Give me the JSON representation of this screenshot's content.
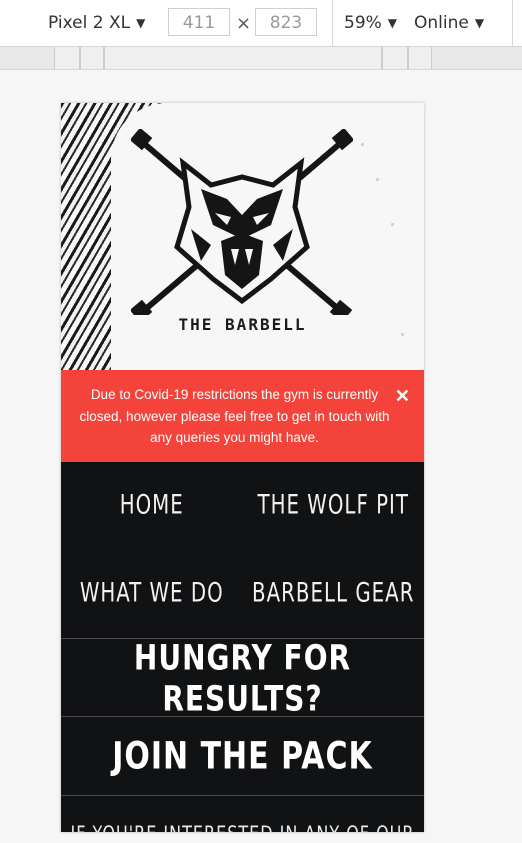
{
  "devtools": {
    "device": "Pixel 2 XL",
    "width": "411",
    "height": "823",
    "zoom": "59%",
    "network": "Online",
    "times_symbol": "×"
  },
  "site": {
    "brand": "THE BARBELL",
    "notice": {
      "text": "Due to Covid-19 restrictions the gym is currently closed, however please feel free to get in touch with any queries you might have.",
      "close": "✕"
    },
    "nav": [
      {
        "label": "HOME"
      },
      {
        "label": "THE WOLF PIT"
      },
      {
        "label": "WHAT WE DO"
      },
      {
        "label": "BARBELL GEAR"
      }
    ],
    "headline": "HUNGRY FOR RESULTS?",
    "cta": "JOIN THE PACK",
    "body_partial": "IF YOU'RE INTERESTED IN ANY OF OUR"
  },
  "colors": {
    "notice_bg": "#f4433a",
    "page_bg": "#111214"
  },
  "icons": [
    "caret-down-icon",
    "wolf-logo",
    "close-icon"
  ]
}
